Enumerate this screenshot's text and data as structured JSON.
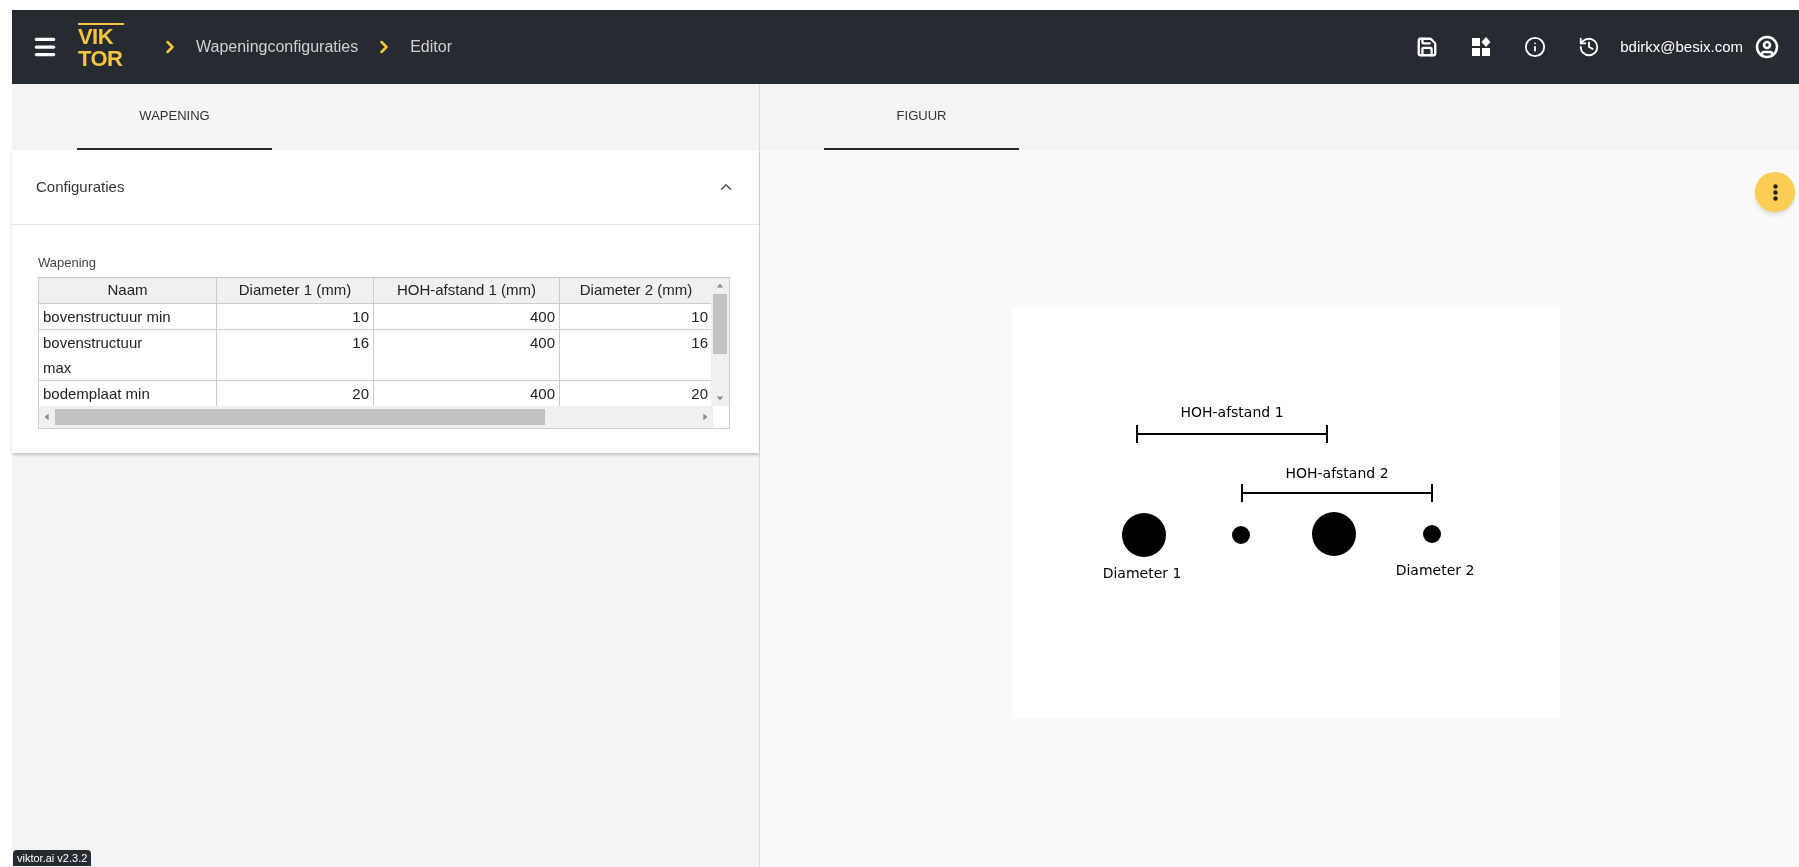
{
  "header": {
    "logo": [
      "VIK",
      "TOR"
    ],
    "breadcrumbs": [
      "Wapeningconfiguraties",
      "Editor"
    ],
    "user": "bdirkx@besix.com"
  },
  "tabs": [
    {
      "label": "WAPENING",
      "selected": true
    },
    {
      "label": "FIGUUR",
      "selected": true
    }
  ],
  "section": {
    "title": "Configuraties",
    "expanded": true
  },
  "table": {
    "label": "Wapening",
    "columns": [
      "Naam",
      "Diameter 1 (mm)",
      "HOH-afstand 1 (mm)",
      "Diameter 2 (mm)"
    ],
    "rows": [
      [
        "bovenstructuur min",
        "10",
        "400",
        "10"
      ],
      [
        "bovenstructuur max",
        "16",
        "400",
        "16"
      ],
      [
        "bodemplaat min",
        "20",
        "400",
        "20"
      ]
    ]
  },
  "figure": {
    "dimension_labels": [
      "HOH-afstand 1",
      "HOH-afstand 2"
    ],
    "bar_labels": [
      "Diameter 1",
      "Diameter 2"
    ]
  },
  "version": "viktor.ai v2.3.2"
}
